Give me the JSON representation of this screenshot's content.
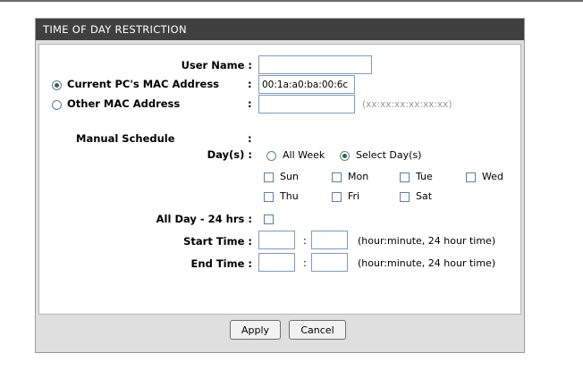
{
  "section": {
    "title": "TIME OF DAY RESTRICTION"
  },
  "form": {
    "user_name_label": "User Name :",
    "user_name_value": "",
    "current_mac_label": "Current PC's MAC Address",
    "current_mac_colon": ":",
    "current_mac_value": "00:1a:a0:ba:00:6c",
    "other_mac_label": "Other MAC Address",
    "other_mac_colon": ":",
    "other_mac_value": "",
    "mac_hint": "(xx:xx:xx:xx:xx:xx)",
    "manual_schedule_label": "Manual Schedule",
    "manual_schedule_colon": ":",
    "days_label": "Day(s) :",
    "all_week_label": "All Week",
    "select_days_label": "Select Day(s)",
    "days": {
      "sun": "Sun",
      "mon": "Mon",
      "tue": "Tue",
      "wed": "Wed",
      "thu": "Thu",
      "fri": "Fri",
      "sat": "Sat"
    },
    "all_day_label": "All Day - 24 hrs :",
    "start_time_label": "Start Time :",
    "end_time_label": "End Time :",
    "time_sep": ":",
    "time_hint": "(hour:minute, 24 hour time)",
    "start_hour": "",
    "start_minute": "",
    "end_hour": "",
    "end_minute": ""
  },
  "buttons": {
    "apply": "Apply",
    "cancel": "Cancel"
  },
  "state": {
    "mac_source_selected": "current",
    "day_mode_selected": "select_days",
    "all_day_checked": false
  },
  "colors": {
    "title_bar": "#404040",
    "panel": "#dfdfdf",
    "input_border": "#7a9cc5"
  }
}
